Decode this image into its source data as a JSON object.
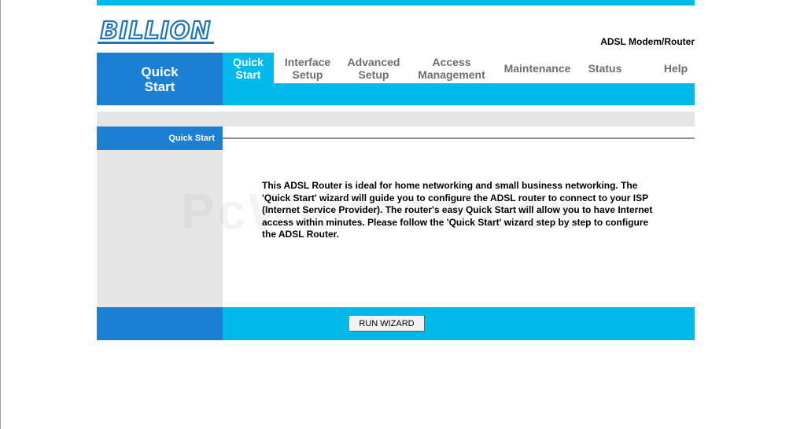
{
  "brand": {
    "logo_text": "BILLION",
    "logo_color": "#1b74b8",
    "product": "ADSL Modem/Router"
  },
  "nav": {
    "section_title_line1": "Quick",
    "section_title_line2": "Start",
    "tabs": [
      {
        "line1": "Quick",
        "line2": "Start",
        "active": true
      },
      {
        "line1": "Interface",
        "line2": "Setup",
        "active": false
      },
      {
        "line1": "Advanced",
        "line2": "Setup",
        "active": false
      },
      {
        "line1": "Access",
        "line2": "Management",
        "active": false
      },
      {
        "line1": "Maintenance",
        "line2": "",
        "active": false
      },
      {
        "line1": "Status",
        "line2": "",
        "active": false
      },
      {
        "line1": "Help",
        "line2": "",
        "active": false
      }
    ]
  },
  "main": {
    "section_label": "Quick Start",
    "intro": "This ADSL Router is ideal for home networking and small business networking. The 'Quick Start' wizard will guide you to configure the ADSL router to connect to your ISP (Internet Service Provider). The router's easy Quick Start will allow you to have Internet access within minutes. Please follow the 'Quick Start' wizard step by step to configure the ADSL Router.",
    "run_wizard_label": "RUN WIZARD",
    "watermark": "PcWintech.com"
  },
  "colors": {
    "accent_dark": "#1b80d4",
    "accent_light": "#00b9eb",
    "panel_gray": "#e6e6e6"
  }
}
